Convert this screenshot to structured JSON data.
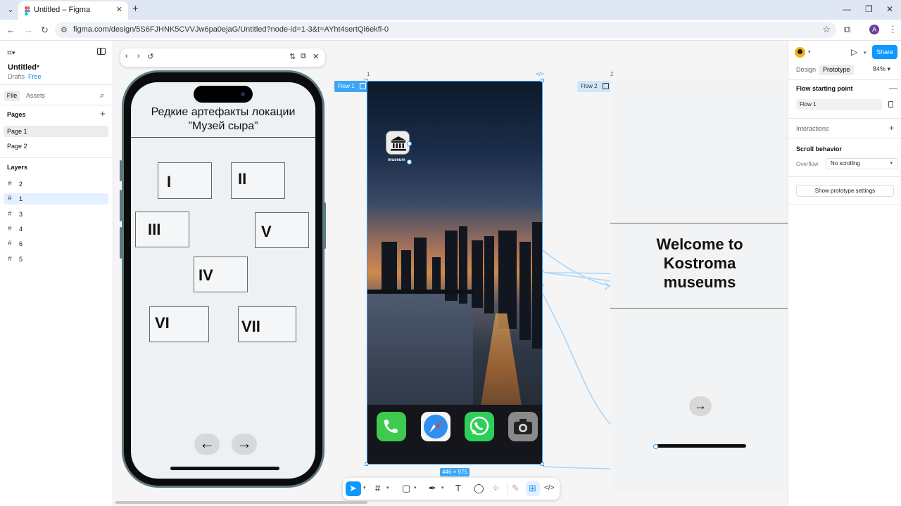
{
  "browser": {
    "tab_title": "Untitled – Figma",
    "url": "figma.com/design/5S6FJHNK5CVVJw6pa0ejaG/Untitled?node-id=1-3&t=AYht4sertQi6ekfl-0",
    "profile_initial": "A"
  },
  "left_panel": {
    "file_name": "Untitled",
    "drafts": "Drafts",
    "plan": "Free",
    "tabs": {
      "file": "File",
      "assets": "Assets"
    },
    "pages_title": "Pages",
    "pages": [
      "Page 1",
      "Page 2"
    ],
    "layers_title": "Layers",
    "layers": [
      "2",
      "1",
      "3",
      "4",
      "6",
      "5"
    ]
  },
  "canvas": {
    "phone": {
      "title_line1": "Редкие артефакты локации",
      "title_line2": "”Музей сыра”",
      "artifacts": [
        "I",
        "II",
        "III",
        "V",
        "IV",
        "VI",
        "VII"
      ],
      "prev_arrow": "←",
      "next_arrow": "→"
    },
    "frame1": {
      "badge": "Flow 1",
      "label_number": "1",
      "code_glyph": "</>",
      "app_label": "museum",
      "size": "446 × 975"
    },
    "frame2": {
      "badge": "Flow 2",
      "label_number": "2",
      "welcome": [
        "Welcome to",
        "Kostroma",
        "museums"
      ],
      "arrow": "→"
    }
  },
  "right_panel": {
    "share": "Share",
    "tabs": {
      "design": "Design",
      "prototype": "Prototype"
    },
    "zoom": "84%",
    "flow_start_title": "Flow starting point",
    "flow_name": "Flow 1",
    "interactions": "Interactions",
    "scroll_behavior": "Scroll behavior",
    "overflow_label": "Overflow",
    "overflow_value": "No scrolling",
    "show_proto_settings": "Show prototype settings"
  },
  "help": "?",
  "colors": {
    "accent": "#0d99ff",
    "flow_badge": "#3da6f5",
    "connector": "#a9d6fa"
  }
}
